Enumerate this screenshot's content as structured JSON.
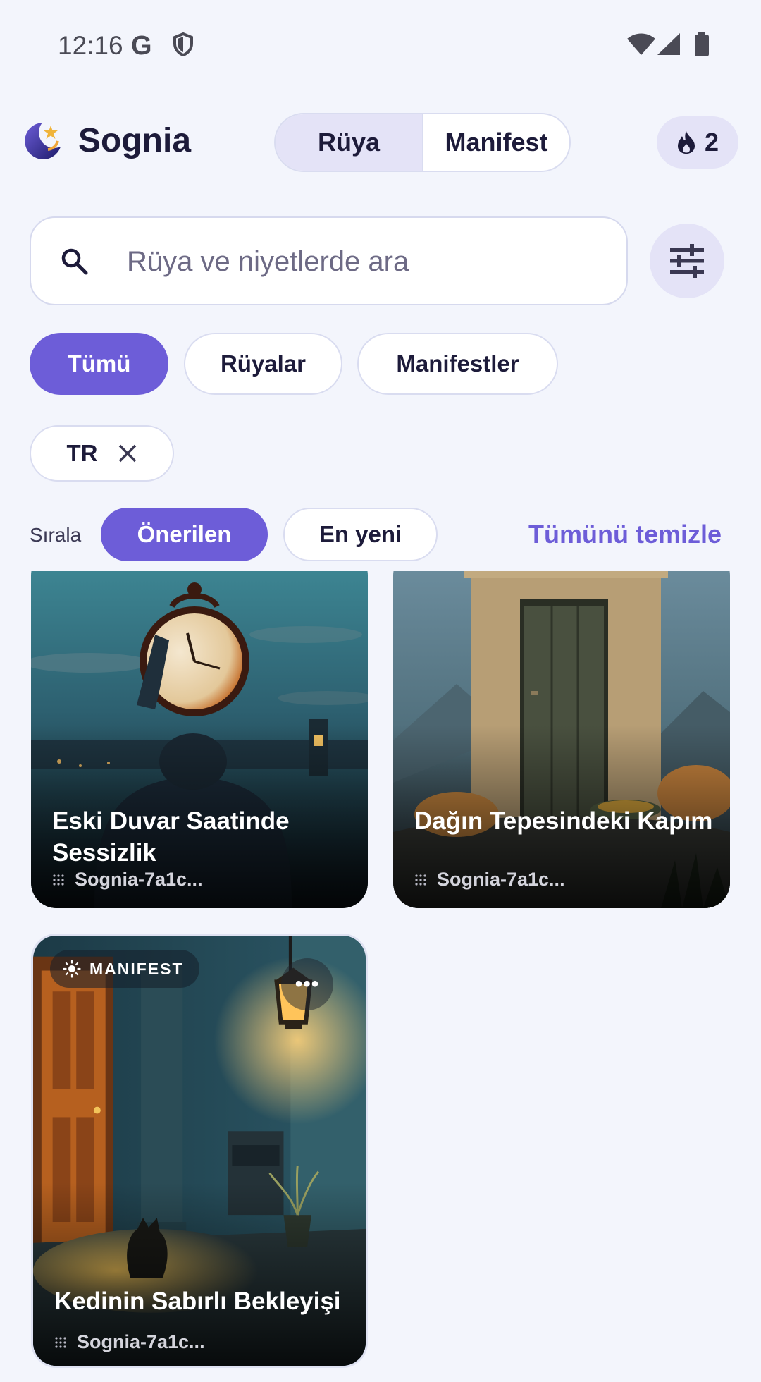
{
  "status_bar": {
    "time": "12:16",
    "g_letter": "G",
    "icons": [
      "google-icon",
      "shield-icon",
      "wifi-icon",
      "signal-icon",
      "battery-icon"
    ]
  },
  "header": {
    "app_name": "Sognia",
    "logo_icon": "moon-star-logo-icon",
    "segments": [
      {
        "label": "Rüya",
        "selected": true
      },
      {
        "label": "Manifest",
        "selected": false
      }
    ],
    "streak": {
      "icon": "flame-icon",
      "count": "2"
    }
  },
  "search": {
    "placeholder": "Rüya ve niyetlerde ara",
    "value": "",
    "filter_icon": "sliders-icon"
  },
  "type_filters": [
    {
      "label": "Tümü",
      "selected": true
    },
    {
      "label": "Rüyalar",
      "selected": false
    },
    {
      "label": "Manifestler",
      "selected": false
    }
  ],
  "language_chip": {
    "label": "TR",
    "remove_icon": "close-icon"
  },
  "sort": {
    "label": "Sırala",
    "options": [
      {
        "label": "Önerilen",
        "selected": true
      },
      {
        "label": "En yeni",
        "selected": false
      }
    ],
    "clear_all": "Tümünü temizle"
  },
  "cards": [
    {
      "title": "Eski Duvar Saatinde Sessizlik",
      "author": "Sognia-7a1c...",
      "badge": null
    },
    {
      "title": "Dağın Tepesindeki Kapım",
      "author": "Sognia-7a1c...",
      "badge": null
    },
    {
      "title": "Kedinin Sabırlı Bekleyişi",
      "author": "Sognia-7a1c...",
      "badge": "MANIFEST",
      "more": "•••"
    }
  ],
  "colors": {
    "accent": "#6d5dd8",
    "background": "#f3f5fc",
    "chip_tint": "#e4e3f7",
    "text": "#1d1b3a"
  }
}
